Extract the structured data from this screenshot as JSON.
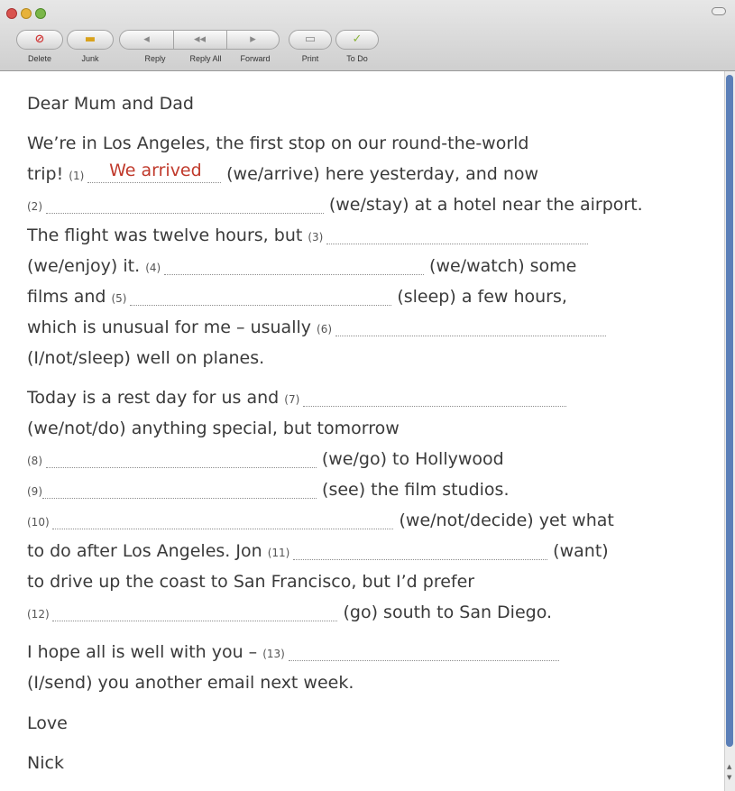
{
  "window": {
    "toolbar": {
      "delete_label": "Delete",
      "junk_label": "Junk",
      "reply_label": "Reply",
      "reply_all_label": "Reply All",
      "forward_label": "Forward",
      "print_label": "Print",
      "todo_label": "To Do"
    }
  },
  "letter": {
    "greeting": "Dear Mum and Dad",
    "l2": "We’re in Los Angeles, the first stop on our round-the-world",
    "l3a": "trip! ",
    "n1": "(1) ",
    "answer1": "We arrived",
    "l3b": " (we/arrive) here yesterday, and now",
    "n2": "(2) ",
    "l4b": " (we/stay) at a hotel near the airport.",
    "l5a": "The flight was twelve hours, but ",
    "n3": "(3) ",
    "l6a": "(we/enjoy) it. ",
    "n4": "(4) ",
    "l6b": " (we/watch) some",
    "l7a": "films and ",
    "n5": "(5) ",
    "l7b": " (sleep) a few hours,",
    "l8a": "which is unusual for me – usually ",
    "n6": "(6) ",
    "l9": "(I/not/sleep) well on planes.",
    "l10a": "Today is a rest day for us and ",
    "n7": "(7) ",
    "l11": "(we/not/do) anything special, but tomorrow",
    "n8": "(8) ",
    "l12b": " (we/go) to Hollywood",
    "n9": "(9)",
    "l13b": " (see) the film studios.",
    "n10": "(10) ",
    "l14b": " (we/not/decide) yet what",
    "l15a": "to do after Los Angeles. Jon ",
    "n11": "(11) ",
    "l15b": " (want)",
    "l16": "to drive up the coast to San Francisco, but I’d prefer",
    "n12": "(12) ",
    "l17b": " (go) south to San Diego.",
    "l18a": "I hope all is well with you – ",
    "n13": "(13) ",
    "l19": "(I/send) you another email next week.",
    "closing": "Love",
    "signature": "Nick"
  },
  "colors": {
    "answer": "#c0392b",
    "scroll_thumb": "#5b7fb8"
  },
  "icons": [
    "delete-icon",
    "junk-icon",
    "reply-icon",
    "reply-all-icon",
    "forward-icon",
    "print-icon",
    "todo-icon"
  ]
}
